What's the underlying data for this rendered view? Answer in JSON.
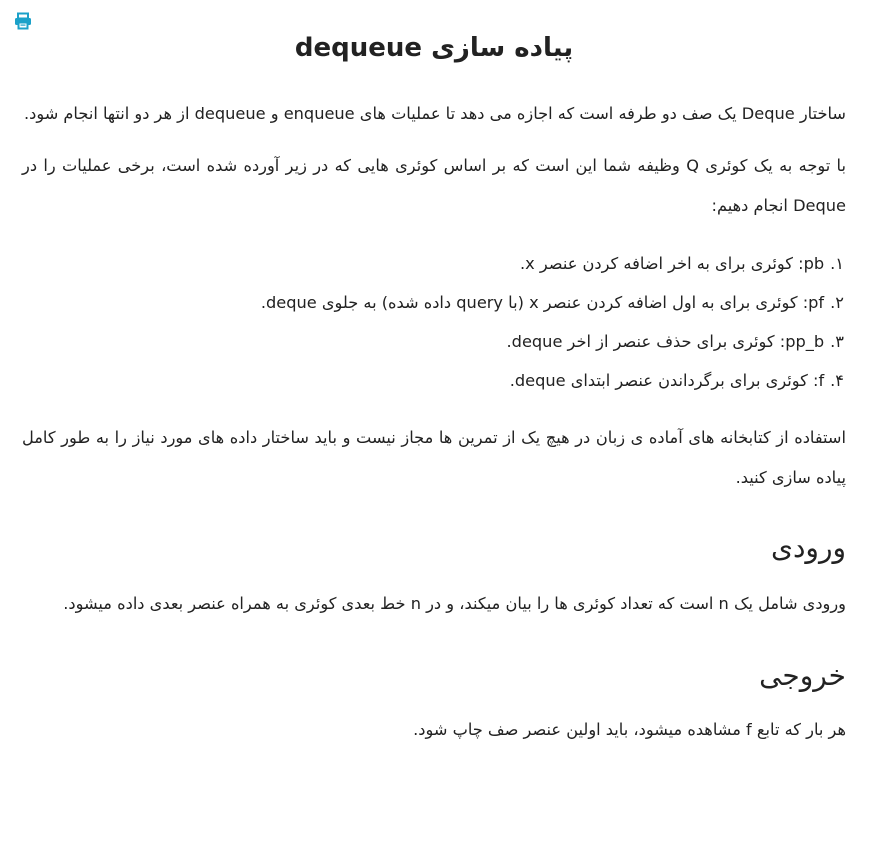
{
  "print_icon_color": "#1ba1c9",
  "title": "پیاده سازی dequeue",
  "intro_paragraph": "ساختار Deque یک صف دو طرفه است که اجازه می دهد تا عملیات های enqueue و dequeue از هر دو انتها انجام شود.",
  "task_paragraph": "با توجه به یک کوئری Q وظیفه شما این است که بر اساس کوئری هایی که در زیر آورده شده است، برخی عملیات را در Deque انجام دهیم:",
  "operations": [
    {
      "number": "۱.",
      "text": "pb: کوئری برای به اخر اضافه کردن عنصر x."
    },
    {
      "number": "۲.",
      "text": "pf: کوئری برای به اول اضافه کردن عنصر x (با query داده شده) به جلوی deque."
    },
    {
      "number": "۳.",
      "text": "pp_b: کوئری برای حذف عنصر از اخر deque."
    },
    {
      "number": "۴.",
      "text": "f: کوئری برای برگرداندن عنصر ابتدای deque."
    }
  ],
  "library_paragraph": "استفاده از کتابخانه های آماده ی زبان در هیچ یک از تمرین ها مجاز نیست و باید ساختار داده های مورد نیاز را به طور کامل پیاده سازی کنید.",
  "input_heading": "ورودی",
  "input_paragraph": "ورودی شامل یک n است که تعداد کوئری ها را بیان میکند، و در n خط بعدی کوئری به همراه عنصر بعدی داده میشود.",
  "output_heading": "خروجی",
  "output_paragraph": "هر بار که تابع f مشاهده میشود، باید اولین عنصر صف چاپ شود."
}
